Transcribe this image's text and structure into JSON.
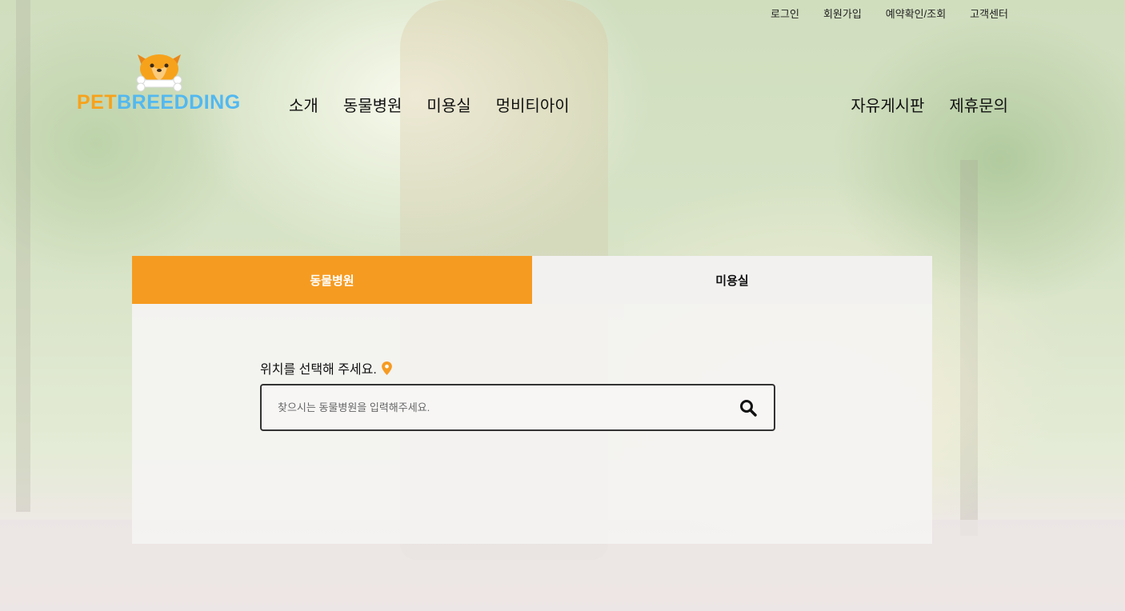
{
  "colors": {
    "accent": "#f69b21",
    "logo_orange": "#f7a21b",
    "logo_blue": "#52b8f0"
  },
  "util_links": [
    "로그인",
    "회원가입",
    "예약확인/조회",
    "고객센터"
  ],
  "logo": {
    "part1": "PET",
    "part2": "BREEDDING",
    "icon": "dog-bone-icon"
  },
  "nav": {
    "left": [
      "소개",
      "동물병원",
      "미용실",
      "멍비티아이"
    ],
    "right": [
      "자유게시판",
      "제휴문의"
    ]
  },
  "search_panel": {
    "tabs": [
      {
        "label": "동물병원",
        "active": true
      },
      {
        "label": "미용실",
        "active": false
      }
    ],
    "location_label": "위치를 선택해 주세요.",
    "location_icon": "map-pin-icon",
    "input_placeholder": "찾으시는 동물병원을 입력해주세요.",
    "input_value": "",
    "search_icon": "search-icon"
  }
}
